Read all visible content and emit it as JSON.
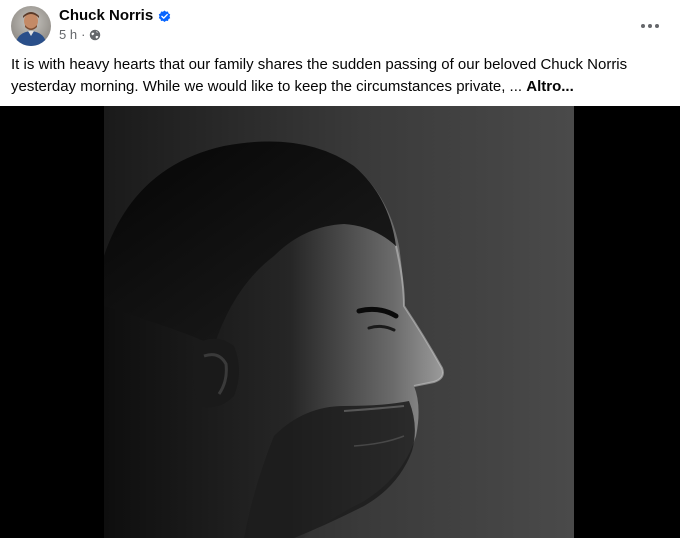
{
  "post": {
    "author": {
      "name": "Chuck Norris",
      "verified": true,
      "avatar_icon": "avatar-photo"
    },
    "time": "5 h",
    "separator": "·",
    "audience_icon": "globe-icon",
    "more_icon": "more-horizontal-icon",
    "text": "It is with heavy hearts that our family shares the sudden passing of our beloved Chuck Norris yesterday morning. While we would like to keep the circumstances private, ...",
    "see_more": "Altro...",
    "photo": {
      "description_icon": "portrait-photo"
    }
  },
  "colors": {
    "verified_blue": "#0866ff",
    "secondary_text": "#65676b",
    "primary_text": "#050505",
    "media_background": "#000000"
  }
}
